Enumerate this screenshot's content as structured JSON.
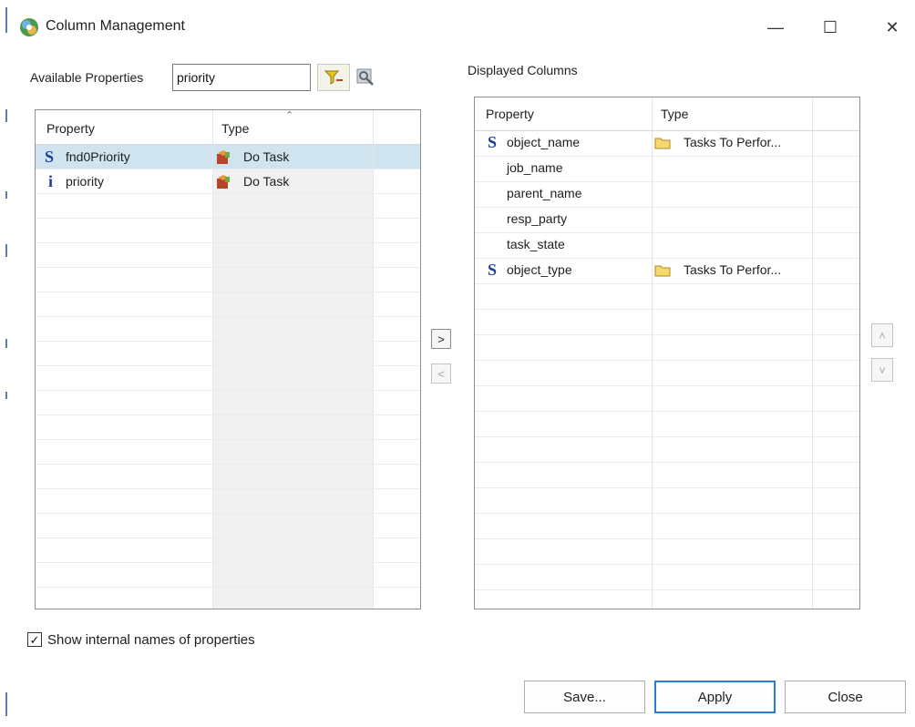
{
  "window": {
    "title": "Column Management",
    "minimize_label": "—",
    "maximize_label": "☐",
    "close_label": "✕"
  },
  "available": {
    "label": "Available Properties",
    "search_value": "priority",
    "columns": {
      "property": "Property",
      "type": "Type"
    },
    "sort_indicator": "ˆ",
    "rows": [
      {
        "icon": "S",
        "property": "fnd0Priority",
        "type": "Do Task",
        "selected": true
      },
      {
        "icon": "i",
        "property": "priority",
        "type": "Do Task",
        "selected": false
      }
    ]
  },
  "displayed": {
    "label": "Displayed Columns",
    "columns": {
      "property": "Property",
      "type": "Type"
    },
    "rows": [
      {
        "icon": "S",
        "property": "object_name",
        "type": "Tasks To Perfor..."
      },
      {
        "icon": "",
        "property": "job_name",
        "type": ""
      },
      {
        "icon": "",
        "property": "parent_name",
        "type": ""
      },
      {
        "icon": "",
        "property": "resp_party",
        "type": ""
      },
      {
        "icon": "",
        "property": "task_state",
        "type": ""
      },
      {
        "icon": "S",
        "property": "object_type",
        "type": "Tasks To Perfor..."
      }
    ]
  },
  "move_buttons": {
    "add": ">",
    "remove": "<",
    "up": "˄",
    "down": "˅"
  },
  "show_internal": {
    "label": "Show internal names of properties",
    "checked": true,
    "check_glyph": "✓"
  },
  "buttons": {
    "save": "Save...",
    "apply": "Apply",
    "close": "Close"
  },
  "colors": {
    "selected_row": "#cfe4ee",
    "accent": "#2b7bd6",
    "icon_blue": "#1d3f9a"
  }
}
